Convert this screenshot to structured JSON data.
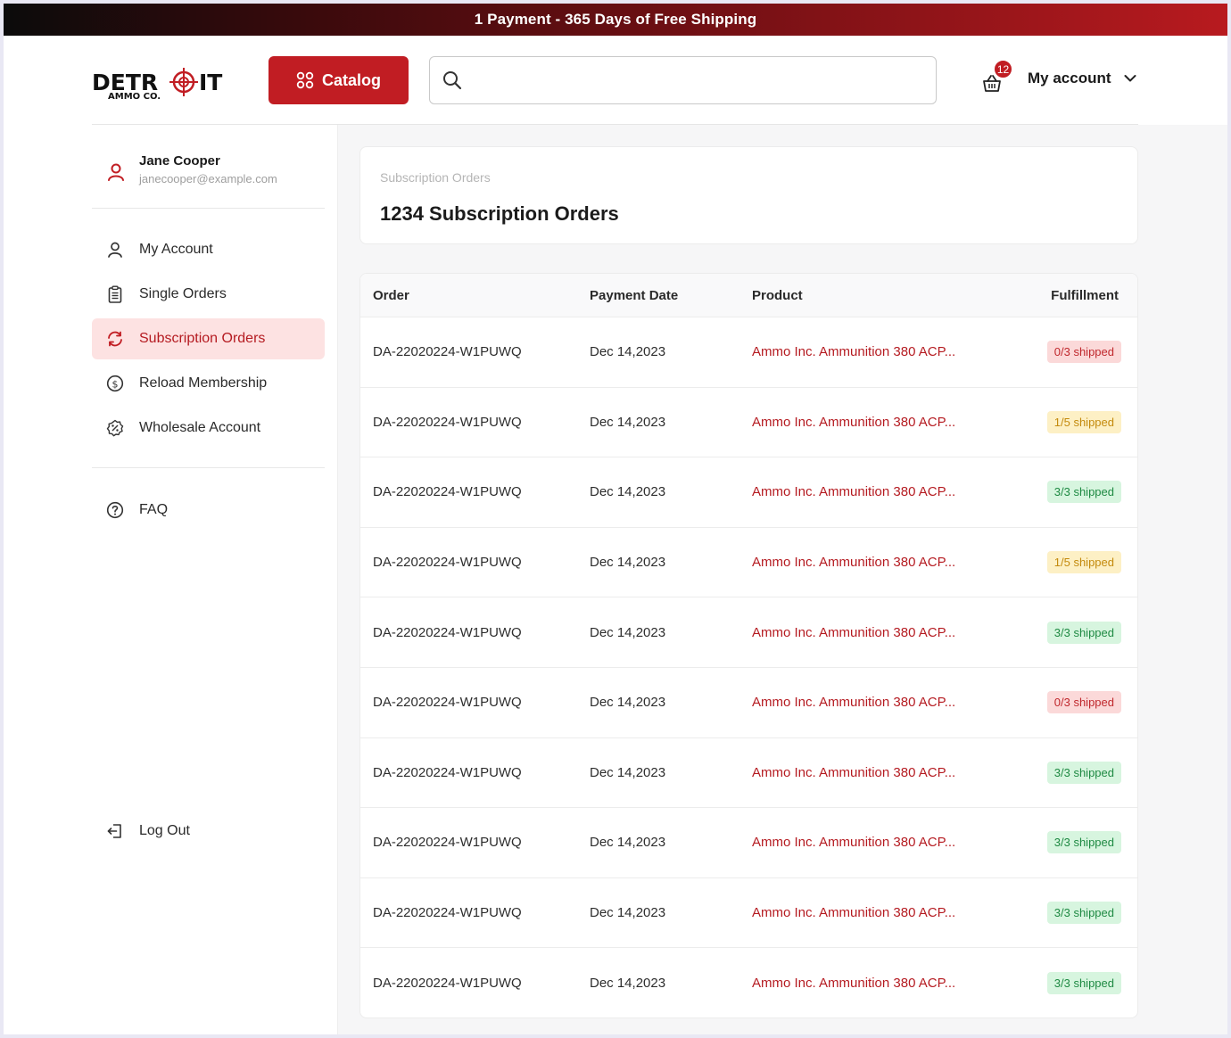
{
  "promo": {
    "text": "1 Payment - 365 Days of Free Shipping"
  },
  "logo": {
    "brand": "DETROIT",
    "sub": "AMMO CO."
  },
  "header": {
    "catalog_label": "Catalog",
    "search_placeholder": "",
    "cart_count": "12",
    "account_label": "My account"
  },
  "user": {
    "name": "Jane Cooper",
    "email": "janecooper@example.com"
  },
  "sidebar": {
    "items": [
      {
        "label": "My Account",
        "icon": "user-icon"
      },
      {
        "label": "Single Orders",
        "icon": "clipboard-icon"
      },
      {
        "label": "Subscription Orders",
        "icon": "refresh-icon",
        "active": true
      },
      {
        "label": "Reload Membership",
        "icon": "dollar-icon"
      },
      {
        "label": "Wholesale Account",
        "icon": "badge-percent-icon"
      }
    ],
    "faq": "FAQ",
    "logout": "Log Out"
  },
  "page": {
    "breadcrumb": "Subscription Orders",
    "title": "1234 Subscription Orders"
  },
  "table": {
    "headers": {
      "order": "Order",
      "date": "Payment Date",
      "product": "Product",
      "fulfillment": "Fulfillment"
    },
    "rows": [
      {
        "order": "DA-22020224-W1PUWQ",
        "date": "Dec 14,2023",
        "product": "Ammo Inc. Ammunition 380 ACP...",
        "status": "0/3 shipped",
        "tone": "red"
      },
      {
        "order": "DA-22020224-W1PUWQ",
        "date": "Dec 14,2023",
        "product": "Ammo Inc. Ammunition 380 ACP...",
        "status": "1/5 shipped",
        "tone": "yellow"
      },
      {
        "order": "DA-22020224-W1PUWQ",
        "date": "Dec 14,2023",
        "product": "Ammo Inc. Ammunition 380 ACP...",
        "status": "3/3 shipped",
        "tone": "green"
      },
      {
        "order": "DA-22020224-W1PUWQ",
        "date": "Dec 14,2023",
        "product": "Ammo Inc. Ammunition 380 ACP...",
        "status": "1/5 shipped",
        "tone": "yellow"
      },
      {
        "order": "DA-22020224-W1PUWQ",
        "date": "Dec 14,2023",
        "product": "Ammo Inc. Ammunition 380 ACP...",
        "status": "3/3 shipped",
        "tone": "green"
      },
      {
        "order": "DA-22020224-W1PUWQ",
        "date": "Dec 14,2023",
        "product": "Ammo Inc. Ammunition 380 ACP...",
        "status": "0/3 shipped",
        "tone": "red"
      },
      {
        "order": "DA-22020224-W1PUWQ",
        "date": "Dec 14,2023",
        "product": "Ammo Inc. Ammunition 380 ACP...",
        "status": "3/3 shipped",
        "tone": "green"
      },
      {
        "order": "DA-22020224-W1PUWQ",
        "date": "Dec 14,2023",
        "product": "Ammo Inc. Ammunition 380 ACP...",
        "status": "3/3 shipped",
        "tone": "green"
      },
      {
        "order": "DA-22020224-W1PUWQ",
        "date": "Dec 14,2023",
        "product": "Ammo Inc. Ammunition 380 ACP...",
        "status": "3/3 shipped",
        "tone": "green"
      },
      {
        "order": "DA-22020224-W1PUWQ",
        "date": "Dec 14,2023",
        "product": "Ammo Inc. Ammunition 380 ACP...",
        "status": "3/3 shipped",
        "tone": "green"
      }
    ]
  },
  "colors": {
    "brand_red": "#c11d23",
    "active_bg": "#fde2e2"
  }
}
